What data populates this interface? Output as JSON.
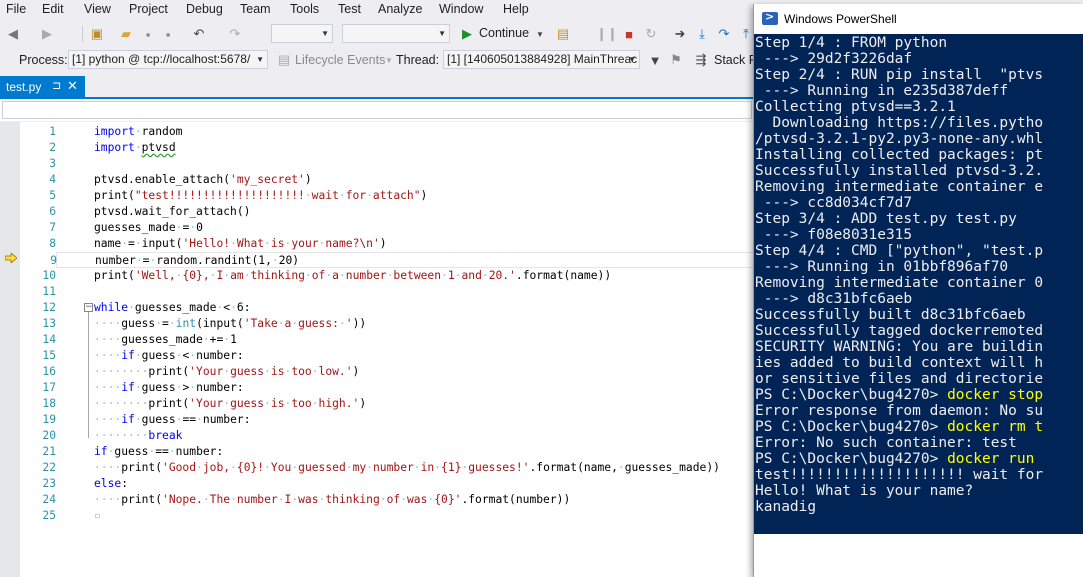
{
  "menu": [
    "File",
    "Edit",
    "View",
    "Project",
    "Debug",
    "Team",
    "Tools",
    "Test",
    "Analyze",
    "Window",
    "Help"
  ],
  "toolbar": {
    "continue_label": "Continue",
    "process_label": "Process:",
    "process_value": "[1] python @ tcp://localhost:5678/",
    "lifecycle_label": "Lifecycle Events",
    "thread_label": "Thread:",
    "thread_value": "[1] [140605013884928] MainThreac",
    "stack_label": "Stack Fr"
  },
  "tab": {
    "label": "test.py",
    "pin": "⊐",
    "close": "✕"
  },
  "editor": {
    "current_line": 9,
    "lines": [
      {
        "n": "1",
        "html": "<span class=\"kw\">import</span><span class=\"ws\">·</span>random"
      },
      {
        "n": "2",
        "html": "<span class=\"kw\">import</span><span class=\"ws\">·</span><span class=\"squiggle\">ptvsd</span>"
      },
      {
        "n": "3",
        "html": ""
      },
      {
        "n": "4",
        "html": "ptvsd.enable_attach(<span class=\"str\">'my_secret'</span>)"
      },
      {
        "n": "5",
        "html": "print(<span class=\"str\">\"test!!!!!!!!!!!!!!!!!!!!<span class=\"ws\">·</span>wait<span class=\"ws\">·</span>for<span class=\"ws\">·</span>attach\"</span>)"
      },
      {
        "n": "6",
        "html": "ptvsd.wait_for_attach()"
      },
      {
        "n": "7",
        "html": "guesses_made<span class=\"ws\">·</span>=<span class=\"ws\">·</span>0"
      },
      {
        "n": "8",
        "html": "name<span class=\"ws\">·</span>=<span class=\"ws\">·</span>input(<span class=\"str\">'Hello!<span class=\"ws\">·</span>What<span class=\"ws\">·</span>is<span class=\"ws\">·</span>your<span class=\"ws\">·</span>name?\\n'</span>)"
      },
      {
        "n": "9",
        "html": "number<span class=\"ws\">·</span>=<span class=\"ws\">·</span>random.randint(1,<span class=\"ws\">·</span>20)"
      },
      {
        "n": "10",
        "html": "print(<span class=\"str\">'Well,<span class=\"ws\">·</span>{0},<span class=\"ws\">·</span>I<span class=\"ws\">·</span>am<span class=\"ws\">·</span>thinking<span class=\"ws\">·</span>of<span class=\"ws\">·</span>a<span class=\"ws\">·</span>number<span class=\"ws\">·</span>between<span class=\"ws\">·</span>1<span class=\"ws\">·</span>and<span class=\"ws\">·</span>20.'</span>.format(name))"
      },
      {
        "n": "11",
        "html": ""
      },
      {
        "n": "12",
        "html": "<span class=\"kw\">while</span><span class=\"ws\">·</span>guesses_made<span class=\"ws\">·</span>&lt;<span class=\"ws\">·</span>6:"
      },
      {
        "n": "13",
        "html": "<span class=\"ws\">····</span>guess<span class=\"ws\">·</span>=<span class=\"ws\">·</span><span class=\"builtin\">int</span>(input(<span class=\"str\">'Take<span class=\"ws\">·</span>a<span class=\"ws\">·</span>guess:<span class=\"ws\">·</span>'</span>))"
      },
      {
        "n": "14",
        "html": "<span class=\"ws\">····</span>guesses_made<span class=\"ws\">·</span>+=<span class=\"ws\">·</span>1"
      },
      {
        "n": "15",
        "html": "<span class=\"ws\">····</span><span class=\"kw\">if</span><span class=\"ws\">·</span>guess<span class=\"ws\">·</span>&lt;<span class=\"ws\">·</span>number:"
      },
      {
        "n": "16",
        "html": "<span class=\"ws\">········</span>print(<span class=\"str\">'Your<span class=\"ws\">·</span>guess<span class=\"ws\">·</span>is<span class=\"ws\">·</span>too<span class=\"ws\">·</span>low.'</span>)"
      },
      {
        "n": "17",
        "html": "<span class=\"ws\">····</span><span class=\"kw\">if</span><span class=\"ws\">·</span>guess<span class=\"ws\">·</span>&gt;<span class=\"ws\">·</span>number:"
      },
      {
        "n": "18",
        "html": "<span class=\"ws\">········</span>print(<span class=\"str\">'Your<span class=\"ws\">·</span>guess<span class=\"ws\">·</span>is<span class=\"ws\">·</span>too<span class=\"ws\">·</span>high.'</span>)"
      },
      {
        "n": "19",
        "html": "<span class=\"ws\">····</span><span class=\"kw\">if</span><span class=\"ws\">·</span>guess<span class=\"ws\">·</span>==<span class=\"ws\">·</span>number:"
      },
      {
        "n": "20",
        "html": "<span class=\"ws\">········</span><span class=\"kw\">break</span>"
      },
      {
        "n": "21",
        "html": "<span class=\"kw\">if</span><span class=\"ws\">·</span>guess<span class=\"ws\">·</span>==<span class=\"ws\">·</span>number:"
      },
      {
        "n": "22",
        "html": "<span class=\"ws\">····</span>print(<span class=\"str\">'Good<span class=\"ws\">·</span>job,<span class=\"ws\">·</span>{0}!<span class=\"ws\">·</span>You<span class=\"ws\">·</span>guessed<span class=\"ws\">·</span>my<span class=\"ws\">·</span>number<span class=\"ws\">·</span>in<span class=\"ws\">·</span>{1}<span class=\"ws\">·</span>guesses!'</span>.format(name,<span class=\"ws\">·</span>guesses_made))"
      },
      {
        "n": "23",
        "html": "<span class=\"kw\">else</span>:"
      },
      {
        "n": "24",
        "html": "<span class=\"ws\">····</span>print(<span class=\"str\">'Nope.<span class=\"ws\">·</span>The<span class=\"ws\">·</span>number<span class=\"ws\">·</span>I<span class=\"ws\">·</span>was<span class=\"ws\">·</span>thinking<span class=\"ws\">·</span>of<span class=\"ws\">·</span>was<span class=\"ws\">·</span>{0}'</span>.format(number))"
      },
      {
        "n": "25",
        "html": "<span class=\"ws\">▫</span>"
      }
    ]
  },
  "powershell": {
    "title": "Windows PowerShell",
    "colors": {
      "background": "#012456",
      "text": "#eeedf0",
      "command": "#ffff00"
    },
    "lines": [
      {
        "text": "Step 1/4 : FROM python"
      },
      {
        "text": " ---> 29d2f3226daf"
      },
      {
        "text": "Step 2/4 : RUN pip install  \"ptvs"
      },
      {
        "text": " ---> Running in e235d387deff"
      },
      {
        "text": "Collecting ptvsd==3.2.1"
      },
      {
        "text": "  Downloading https://files.pytho"
      },
      {
        "text": "/ptvsd-3.2.1-py2.py3-none-any.whl"
      },
      {
        "text": "Installing collected packages: pt"
      },
      {
        "text": "Successfully installed ptvsd-3.2."
      },
      {
        "text": "Removing intermediate container e"
      },
      {
        "text": " ---> cc8d034cf7d7"
      },
      {
        "text": "Step 3/4 : ADD test.py test.py"
      },
      {
        "text": " ---> f08e8031e315"
      },
      {
        "text": "Step 4/4 : CMD [\"python\", \"test.p"
      },
      {
        "text": " ---> Running in 01bbf896af70"
      },
      {
        "text": "Removing intermediate container 0"
      },
      {
        "text": " ---> d8c31bfc6aeb"
      },
      {
        "text": "Successfully built d8c31bfc6aeb"
      },
      {
        "text": "Successfully tagged dockerremoted"
      },
      {
        "text": "SECURITY WARNING: You are buildin"
      },
      {
        "text": "ies added to build context will h"
      },
      {
        "text": "or sensitive files and directorie"
      },
      {
        "prompt": "PS C:\\Docker\\bug4270> ",
        "cmd": "docker stop"
      },
      {
        "text": "Error response from daemon: No su"
      },
      {
        "prompt": "PS C:\\Docker\\bug4270> ",
        "cmd": "docker rm t"
      },
      {
        "text": "Error: No such container: test"
      },
      {
        "prompt": "PS C:\\Docker\\bug4270> ",
        "cmd": "docker run"
      },
      {
        "text": "test!!!!!!!!!!!!!!!!!!!! wait for"
      },
      {
        "text": "Hello! What is your name?"
      },
      {
        "text": "kanadig"
      }
    ]
  }
}
